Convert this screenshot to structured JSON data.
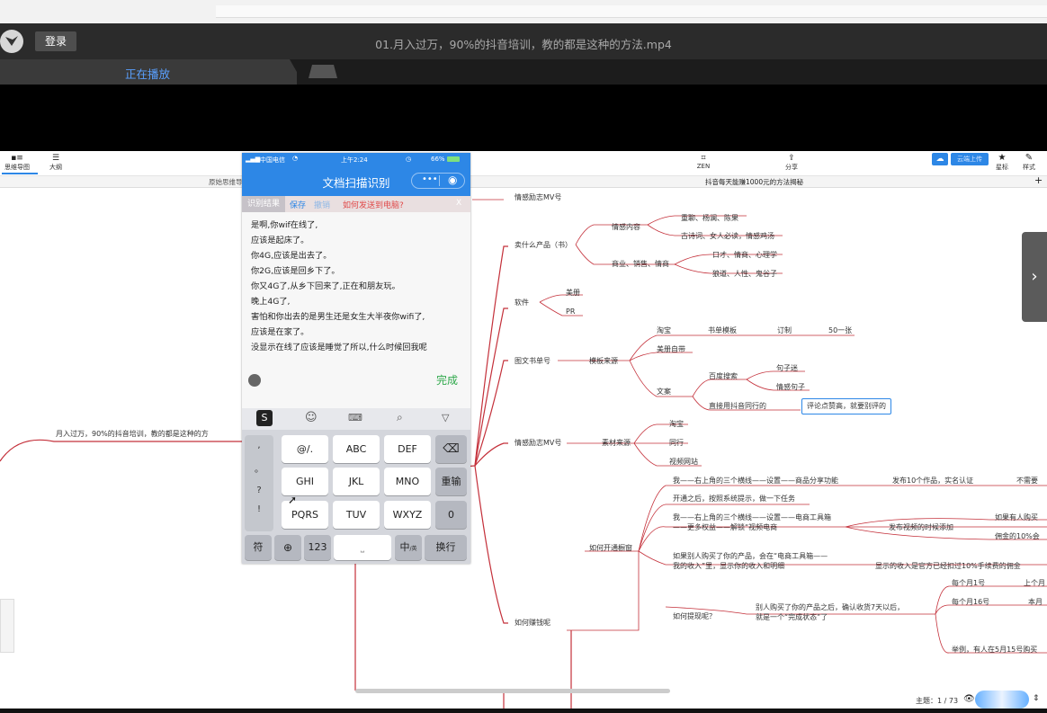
{
  "player": {
    "login_label": "登录",
    "video_title": "01.月入过万，90%的抖音培训，教的都是这种的方法.mp4",
    "tab_now_playing": "正在播放"
  },
  "mindmap": {
    "toolbar": {
      "mindmap_label": "思维导图",
      "outline_label": "大纲",
      "zen_label": "ZEN",
      "share_label": "分享",
      "upload_label": "云端上传",
      "favorite_label": "星标",
      "style_label": "样式"
    },
    "tabs": {
      "left_tab": "原始思维导",
      "center_tab": "抖音每天能赚1000元的方法揭秘"
    },
    "root_text": "月入过万，90%的抖音培训，教的都是这种的方",
    "nodes": {
      "emotion_mv": "情感励志MV号",
      "sell_what": "卖什么产品（书）",
      "emotion_content": "情感内容",
      "love_series": "重聊、杨澜、陈果",
      "poems": "古诗词、女人必读，情感鸡汤",
      "business": "商业、销售、情商",
      "eloquence": "口才、情商、心理学",
      "wolf": "狼道、人性、鬼谷子",
      "software": "软件",
      "meitu": "美册",
      "pr": "PR",
      "picbook": "图文书单号",
      "template_source": "模板来源",
      "taobao": "淘宝",
      "book_template": "书单模板",
      "custom": "订制",
      "fifty": "50一张",
      "meice_self": "美册自带",
      "wenan": "文案",
      "baidu": "百度搜索",
      "juzimi": "句子迷",
      "emotion_sentence": "情感句子",
      "direct_use": "直接用抖音同行的",
      "top_liked": "评论点赞高，就要别评的",
      "emotion_mv2": "情感励志MV号",
      "material_source": "素材来源",
      "taobao2": "淘宝",
      "peers": "同行",
      "video_site": "视频网站",
      "share_func": "我——右上角的三个横线——设置——商品分享功能",
      "ten_works": "发布10个作品，实名认证",
      "no_charge": "不需要",
      "after_open": "开通之后，按照系统提示，做一下任务",
      "shop_tool_1": "我——右上角的三个横线——设置——电商工具箱",
      "shop_tool_2": "——更多权益——解锁“视频电商",
      "publish_add": "发布视频的时候添加",
      "if_buy": "如果有人购买",
      "commission": "佣金的10%会",
      "how_open": "如何开通橱窗",
      "if_bought_1": "如果别人购买了你的产品，会在“电商工具箱——",
      "if_bought_2": "我的收入”里，显示你的收入和明细",
      "shown_income": "显示的收入是官方已经扣过10%手续费的佣金",
      "monthly_1": "每个月1号",
      "top_month": "上个月",
      "monthly_16": "每个月16号",
      "this_month": "本月",
      "after_confirm_1": "别人购买了你的产品之后，确认收货7天以后，",
      "after_confirm_2": "就是一个“完成状态”了",
      "how_withdraw": "如何提现呢？",
      "how_earn": "如何赚钱呢",
      "example": "举例，有人在5月15号购买"
    },
    "status": {
      "theme_label": "主题：",
      "page_count": "1 / 73"
    }
  },
  "phone": {
    "carrier": "中国电信",
    "time": "上午2:24",
    "battery": "66%",
    "app_title": "文档扫描识别",
    "actions": {
      "recognize": "识别结果",
      "save": "保存",
      "undo": "撤销",
      "send_help": "如何发送到电脑?",
      "close": "X"
    },
    "ocr_lines": [
      "是啊,你wif在线了,",
      "应该是起床了。",
      "你4G,应该是出去了。",
      "你2G,应该是回乡下了。",
      "你又4G了,从乡下回来了,正在和朋友玩。",
      "晚上4G了,",
      "害怕和你出去的是男生还是女生大半夜你wifi了,",
      "应该是在家了。",
      "没显示在线了应该是睡觉了所以,什么时候回我呢"
    ],
    "done_label": "完成",
    "keyboard": {
      "row1": [
        "@/.",
        "ABC",
        "DEF"
      ],
      "row2": [
        "GHI",
        "JKL",
        "MNO"
      ],
      "row3": [
        "PQRS",
        "TUV",
        "WXYZ"
      ],
      "reenter": "重输",
      "zero": "0",
      "symbols": [
        ",",
        "。",
        "?",
        "!"
      ],
      "fu": "符",
      "num": "123",
      "zh": "中",
      "zh_sub": "/英",
      "enter": "换行"
    }
  },
  "colors": {
    "accent_blue": "#2d87e6",
    "tab_blue": "#5aa0ff",
    "line_red": "#c4303a",
    "done_green": "#2ea84a"
  }
}
